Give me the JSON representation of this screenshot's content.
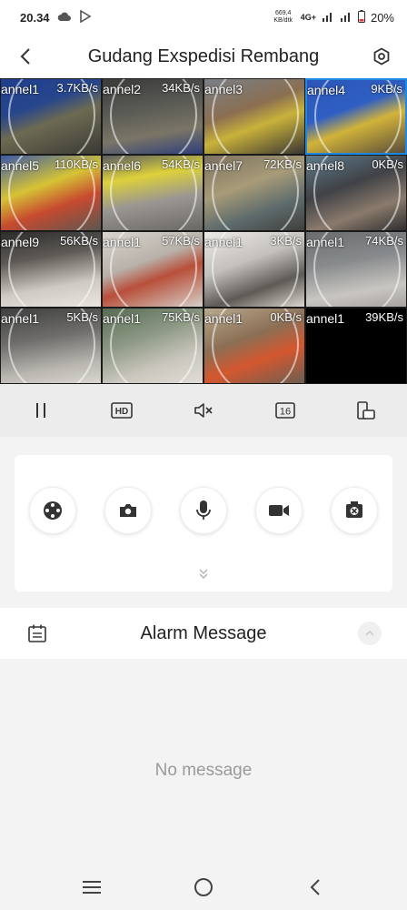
{
  "status_bar": {
    "time": "20.34",
    "net_speed_value": "669,4",
    "net_speed_unit": "KB/dtk",
    "net_type": "4G+",
    "battery": "20%"
  },
  "header": {
    "title": "Gudang Exspedisi Rembang",
    "back_icon": "chevron-left-icon",
    "settings_icon": "hexagon-gear-icon"
  },
  "video_grid": {
    "cells": [
      {
        "channel": "annel1",
        "rate": "3.7KB/s",
        "scene": "warehouse-blue"
      },
      {
        "channel": "annel2",
        "rate": "34KB/s",
        "scene": "warehouse-dark"
      },
      {
        "channel": "annel3",
        "rate": "",
        "scene": "warehouse-yellow"
      },
      {
        "channel": "annel4",
        "rate": "9KB/s",
        "scene": "warehouse-blue-yellow"
      },
      {
        "channel": "annel5",
        "rate": "110KB/s",
        "scene": "truck-yellow"
      },
      {
        "channel": "annel6",
        "rate": "54KB/s",
        "scene": "truck-yard"
      },
      {
        "channel": "annel7",
        "rate": "72KB/s",
        "scene": "storage-boxes"
      },
      {
        "channel": "annel8",
        "rate": "0KB/s",
        "scene": "office-dark"
      },
      {
        "channel": "annel9",
        "rate": "56KB/s",
        "scene": "office-white"
      },
      {
        "channel": "annel1",
        "rate": "57KB/s",
        "scene": "office-desk"
      },
      {
        "channel": "annel1",
        "rate": "3KB/s",
        "scene": "room-fisheye"
      },
      {
        "channel": "annel1",
        "rate": "74KB/s",
        "scene": "room-grey"
      },
      {
        "channel": "annel1",
        "rate": "5KB/s",
        "scene": "corridor-dark"
      },
      {
        "channel": "annel1",
        "rate": "75KB/s",
        "scene": "room-green"
      },
      {
        "channel": "annel1",
        "rate": "0KB/s",
        "scene": "store-shelves"
      },
      {
        "channel": "annel1",
        "rate": "39KB/s",
        "scene": "black"
      }
    ]
  },
  "controls": [
    {
      "name": "pause",
      "icon": "pause-icon"
    },
    {
      "name": "hd",
      "icon": "hd-icon",
      "label": "HD"
    },
    {
      "name": "mute",
      "icon": "speaker-muted-icon"
    },
    {
      "name": "split",
      "icon": "split-16-icon",
      "label": "16"
    },
    {
      "name": "rotate",
      "icon": "rotate-screen-icon"
    }
  ],
  "actions": [
    {
      "name": "ptz",
      "icon": "ptz-joystick-icon"
    },
    {
      "name": "snapshot",
      "icon": "camera-icon"
    },
    {
      "name": "talk",
      "icon": "microphone-icon"
    },
    {
      "name": "record",
      "icon": "video-camera-icon"
    },
    {
      "name": "fisheye",
      "icon": "fisheye-icon"
    }
  ],
  "alarm": {
    "title": "Alarm Message",
    "empty_text": "No message"
  },
  "nav": {
    "menu_icon": "menu-icon",
    "home_icon": "home-circle-icon",
    "back_icon": "back-icon"
  },
  "colors": {
    "accent": "#1e88e5",
    "icon": "#333333",
    "muted_text": "#9a9a9a"
  }
}
